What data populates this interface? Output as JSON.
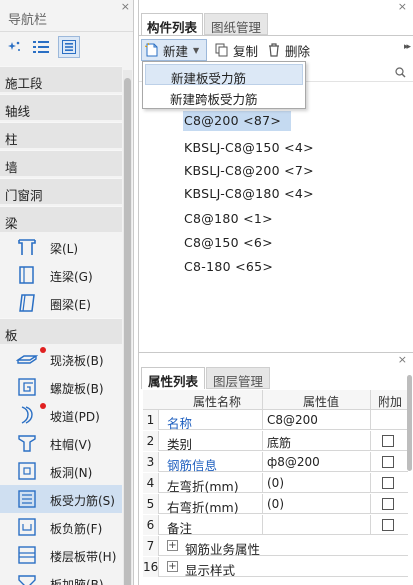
{
  "nav": {
    "title": "导航栏",
    "close": "×",
    "categories": [
      {
        "label": "施工段"
      },
      {
        "label": "轴线"
      },
      {
        "label": "柱"
      },
      {
        "label": "墙"
      },
      {
        "label": "门窗洞"
      },
      {
        "label": "梁"
      },
      {
        "label": "板"
      }
    ],
    "beam_items": [
      {
        "label": "梁(L)",
        "icon": "beam-icon"
      },
      {
        "label": "连梁(G)",
        "icon": "link-beam-icon"
      },
      {
        "label": "圈梁(E)",
        "icon": "ring-beam-icon"
      }
    ],
    "slab_items": [
      {
        "label": "现浇板(B)",
        "icon": "cast-slab-icon",
        "marked": true
      },
      {
        "label": "螺旋板(B)",
        "icon": "spiral-slab-icon",
        "marked": false
      },
      {
        "label": "坡道(PD)",
        "icon": "ramp-icon",
        "marked": true
      },
      {
        "label": "柱帽(V)",
        "icon": "column-cap-icon",
        "marked": false
      },
      {
        "label": "板洞(N)",
        "icon": "slab-hole-icon",
        "marked": false
      },
      {
        "label": "板受力筋(S)",
        "icon": "slab-rebar-icon",
        "marked": false,
        "selected": true
      },
      {
        "label": "板负筋(F)",
        "icon": "negative-rebar-icon",
        "marked": false
      },
      {
        "label": "楼层板带(H)",
        "icon": "slab-strip-icon",
        "marked": false
      },
      {
        "label": "板加腋(B)",
        "icon": "slab-haunch-icon",
        "marked": false
      }
    ]
  },
  "components": {
    "tabs": [
      {
        "label": "构件列表"
      },
      {
        "label": "图纸管理"
      }
    ],
    "toolbar": {
      "new_label": "新建",
      "copy_label": "复制",
      "delete_label": "删除",
      "more": "▸▸"
    },
    "dropdown": [
      {
        "label": "新建板受力筋"
      },
      {
        "label": "新建跨板受力筋"
      }
    ],
    "list": [
      {
        "label": "C8@200 <87>"
      },
      {
        "label": "KBSLJ-C8@150 <4>"
      },
      {
        "label": "KBSLJ-C8@200 <7>"
      },
      {
        "label": "KBSLJ-C8@180 <4>"
      },
      {
        "label": "C8@180 <1>"
      },
      {
        "label": "C8@150 <6>"
      },
      {
        "label": "C8-180 <65>"
      }
    ]
  },
  "properties": {
    "tabs": [
      {
        "label": "属性列表"
      },
      {
        "label": "图层管理"
      }
    ],
    "headers": {
      "name": "属性名称",
      "value": "属性值",
      "extra": "附加"
    },
    "rows": [
      {
        "num": "1",
        "name": "名称",
        "value": "C8@200"
      },
      {
        "num": "2",
        "name": "类别",
        "value": "底筋"
      },
      {
        "num": "3",
        "name": "钢筋信息",
        "value": "ф8@200"
      },
      {
        "num": "4",
        "name": "左弯折(mm)",
        "value": "(0)"
      },
      {
        "num": "5",
        "name": "右弯折(mm)",
        "value": "(0)"
      },
      {
        "num": "6",
        "name": "备注",
        "value": ""
      },
      {
        "num": "7",
        "name": "钢筋业务属性",
        "value": ""
      },
      {
        "num": "16",
        "name": "显示样式",
        "value": ""
      }
    ],
    "expand_symbol": "+"
  },
  "colors": {
    "selection": "#c5daf1",
    "link_blue": "#1e5fbf",
    "marker_red": "#e02020"
  }
}
